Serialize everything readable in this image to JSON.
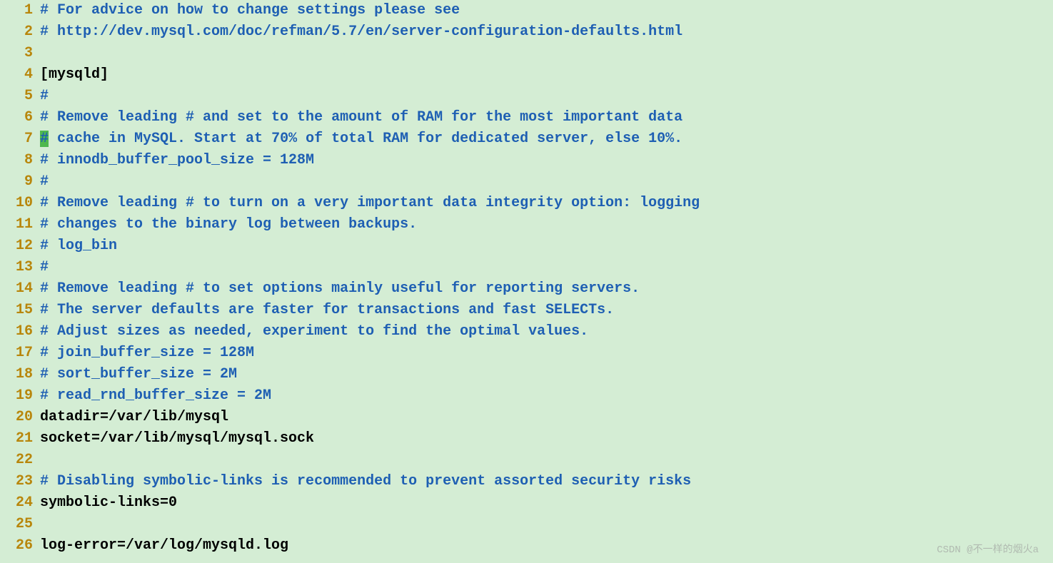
{
  "lines": [
    {
      "num": 1,
      "type": "comment",
      "text": "# For advice on how to change settings please see"
    },
    {
      "num": 2,
      "type": "comment",
      "text": "# http://dev.mysql.com/doc/refman/5.7/en/server-configuration-defaults.html"
    },
    {
      "num": 3,
      "type": "empty",
      "text": ""
    },
    {
      "num": 4,
      "type": "plain",
      "text": "[mysqld]"
    },
    {
      "num": 5,
      "type": "comment",
      "text": "#"
    },
    {
      "num": 6,
      "type": "comment",
      "text": "# Remove leading # and set to the amount of RAM for the most important data"
    },
    {
      "num": 7,
      "type": "comment-cursor",
      "text": "# cache in MySQL. Start at 70% of total RAM for dedicated server, else 10%."
    },
    {
      "num": 8,
      "type": "comment",
      "text": "# innodb_buffer_pool_size = 128M"
    },
    {
      "num": 9,
      "type": "comment",
      "text": "#"
    },
    {
      "num": 10,
      "type": "comment",
      "text": "# Remove leading # to turn on a very important data integrity option: logging"
    },
    {
      "num": 11,
      "type": "comment",
      "text": "# changes to the binary log between backups."
    },
    {
      "num": 12,
      "type": "comment",
      "text": "# log_bin"
    },
    {
      "num": 13,
      "type": "comment",
      "text": "#"
    },
    {
      "num": 14,
      "type": "comment",
      "text": "# Remove leading # to set options mainly useful for reporting servers."
    },
    {
      "num": 15,
      "type": "comment",
      "text": "# The server defaults are faster for transactions and fast SELECTs."
    },
    {
      "num": 16,
      "type": "comment",
      "text": "# Adjust sizes as needed, experiment to find the optimal values."
    },
    {
      "num": 17,
      "type": "comment",
      "text": "# join_buffer_size = 128M"
    },
    {
      "num": 18,
      "type": "comment",
      "text": "# sort_buffer_size = 2M"
    },
    {
      "num": 19,
      "type": "comment",
      "text": "# read_rnd_buffer_size = 2M"
    },
    {
      "num": 20,
      "type": "plain",
      "text": "datadir=/var/lib/mysql"
    },
    {
      "num": 21,
      "type": "plain",
      "text": "socket=/var/lib/mysql/mysql.sock"
    },
    {
      "num": 22,
      "type": "empty",
      "text": ""
    },
    {
      "num": 23,
      "type": "comment",
      "text": "# Disabling symbolic-links is recommended to prevent assorted security risks"
    },
    {
      "num": 24,
      "type": "plain",
      "text": "symbolic-links=0"
    },
    {
      "num": 25,
      "type": "empty",
      "text": ""
    },
    {
      "num": 26,
      "type": "plain",
      "text": "log-error=/var/log/mysqld.log"
    }
  ],
  "watermark": "CSDN @不一样的烟火a"
}
